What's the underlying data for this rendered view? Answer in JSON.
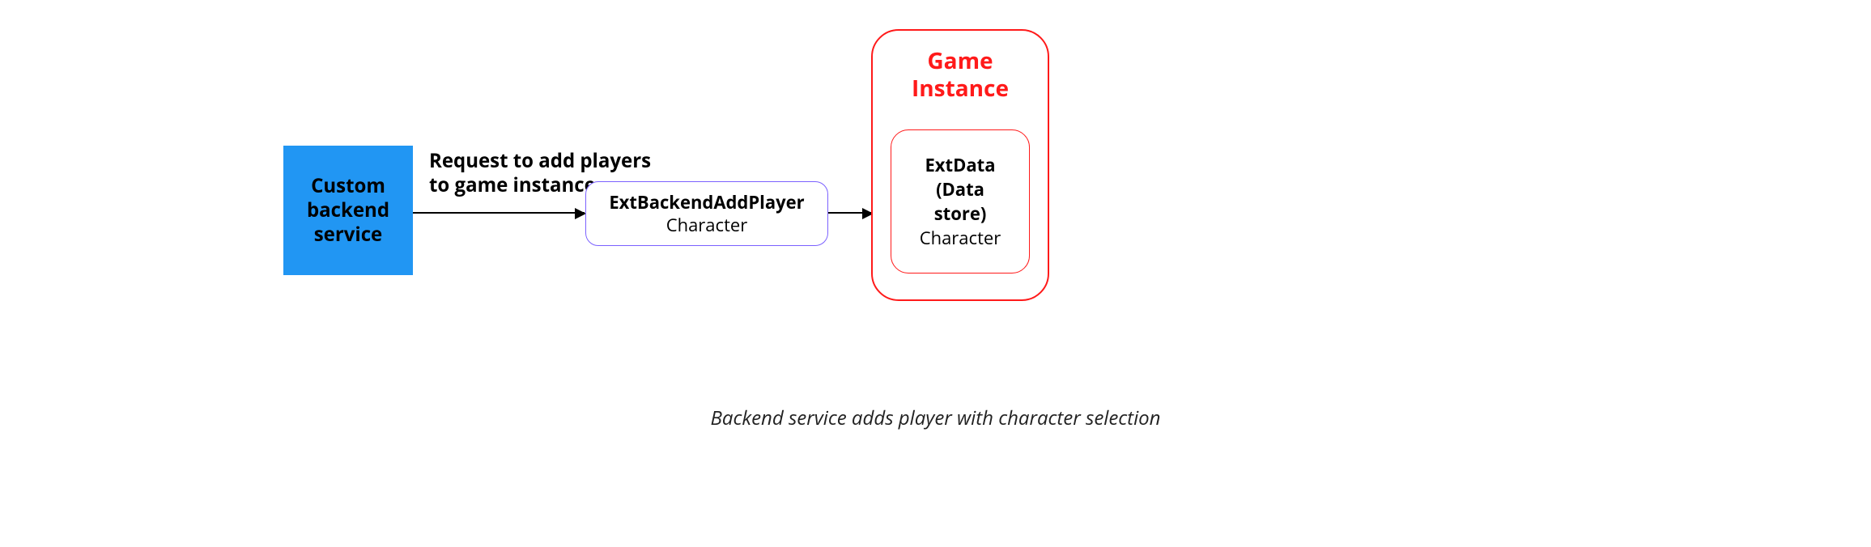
{
  "backend_box": {
    "line1": "Custom",
    "line2": "backend",
    "line3": "service"
  },
  "arrow_label": {
    "line1": "Request to add players",
    "line2": "to game instance"
  },
  "middle_box": {
    "title": "ExtBackendAddPlayer",
    "subtitle": "Character"
  },
  "game_instance": {
    "title_line1": "Game",
    "title_line2": "Instance"
  },
  "extdata_box": {
    "line1": "ExtData",
    "line2": "(Data",
    "line3": "store)",
    "line4": "Character"
  },
  "caption": "Backend service adds player with character selection"
}
